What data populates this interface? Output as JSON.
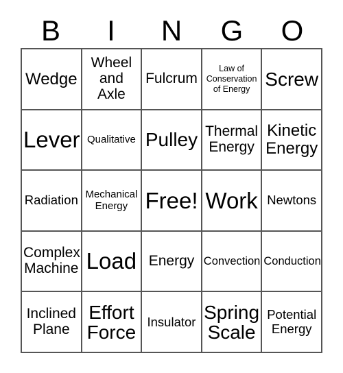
{
  "card": {
    "title": "BINGO",
    "header_letters": [
      "B",
      "I",
      "N",
      "G",
      "O"
    ],
    "grid_colors": {
      "border": "#555555",
      "text": "#000000",
      "background": "#ffffff"
    },
    "rows": [
      [
        {
          "label": "Wedge",
          "size": "l"
        },
        {
          "label": "Wheel\nand\nAxle",
          "size": "ml"
        },
        {
          "label": "Fulcrum",
          "size": "ml"
        },
        {
          "label": "Law of\nConservation\nof Energy",
          "size": "xs"
        },
        {
          "label": "Screw",
          "size": "xl"
        }
      ],
      [
        {
          "label": "Lever",
          "size": "xxl"
        },
        {
          "label": "Qualitative",
          "size": "s"
        },
        {
          "label": "Pulley",
          "size": "xl"
        },
        {
          "label": "Thermal\nEnergy",
          "size": "ml"
        },
        {
          "label": "Kinetic\nEnergy",
          "size": "l"
        }
      ],
      [
        {
          "label": "Radiation",
          "size": "m"
        },
        {
          "label": "Mechanical\nEnergy",
          "size": "s"
        },
        {
          "label": "Free!",
          "size": "xxl"
        },
        {
          "label": "Work",
          "size": "xxl"
        },
        {
          "label": "Newtons",
          "size": "m"
        }
      ],
      [
        {
          "label": "Complex\nMachine",
          "size": "ml"
        },
        {
          "label": "Load",
          "size": "xxl"
        },
        {
          "label": "Energy",
          "size": "ml"
        },
        {
          "label": "Convection",
          "size": "sm"
        },
        {
          "label": "Conduction",
          "size": "sm"
        }
      ],
      [
        {
          "label": "Inclined\nPlane",
          "size": "ml"
        },
        {
          "label": "Effort\nForce",
          "size": "xl"
        },
        {
          "label": "Insulator",
          "size": "m"
        },
        {
          "label": "Spring\nScale",
          "size": "xl"
        },
        {
          "label": "Potential\nEnergy",
          "size": "m"
        }
      ]
    ]
  }
}
